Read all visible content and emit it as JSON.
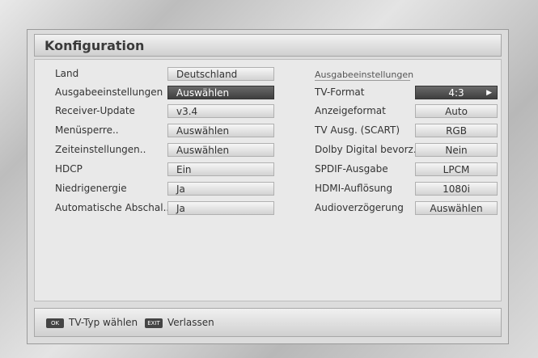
{
  "title": "Konfiguration",
  "left": {
    "rows": [
      {
        "label": "Land",
        "value": "Deutschland"
      },
      {
        "label": "Ausgabeeinstellungen",
        "value": "Auswählen"
      },
      {
        "label": "Receiver-Update",
        "value": "v3.4"
      },
      {
        "label": "Menüsperre..",
        "value": "Auswählen"
      },
      {
        "label": "Zeiteinstellungen..",
        "value": "Auswählen"
      },
      {
        "label": "HDCP",
        "value": "Ein"
      },
      {
        "label": "Niedrigenergie",
        "value": "Ja"
      },
      {
        "label": "Automatische Abschal..",
        "value": "Ja"
      }
    ]
  },
  "right": {
    "section_title": "Ausgabeeinstellungen",
    "rows": [
      {
        "label": "TV-Format",
        "value": "4:3"
      },
      {
        "label": "Anzeigeformat",
        "value": "Auto"
      },
      {
        "label": "TV Ausg. (SCART)",
        "value": "RGB"
      },
      {
        "label": "Dolby Digital bevorz..",
        "value": "Nein"
      },
      {
        "label": "SPDIF-Ausgabe",
        "value": "LPCM"
      },
      {
        "label": "HDMI-Auflösung",
        "value": "1080i"
      },
      {
        "label": "Audioverzögerung",
        "value": "Auswählen"
      }
    ]
  },
  "footer": {
    "key1": "OK",
    "text1": "TV-Typ wählen",
    "key2": "EXIT",
    "text2": "Verlassen"
  },
  "icons": {
    "selected_arrow": "arrow-right-icon"
  }
}
